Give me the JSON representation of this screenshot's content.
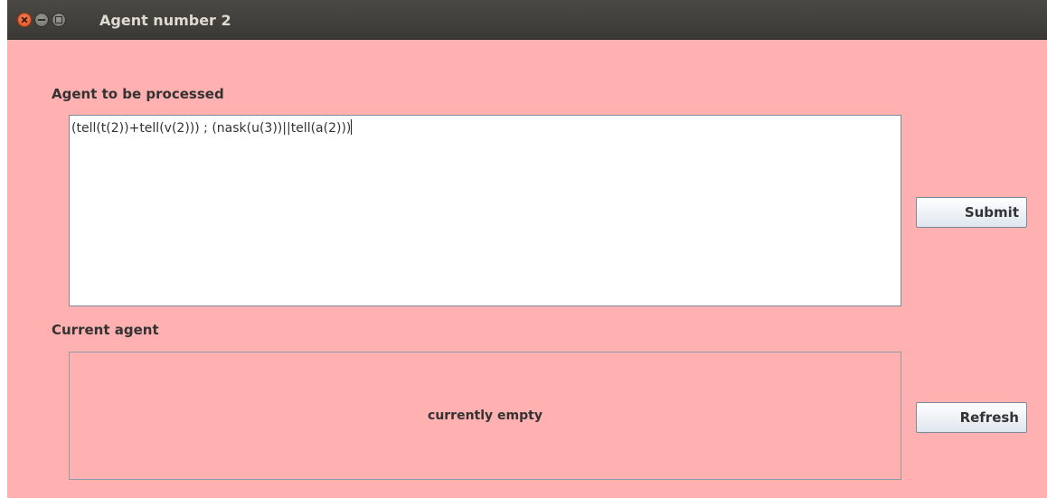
{
  "window": {
    "title": "Agent number 2",
    "controls": [
      "close-icon",
      "minimize-icon",
      "maximize-icon"
    ]
  },
  "input_section": {
    "label": "Agent to be processed",
    "value": "(tell(t(2))+tell(v(2))) ; (nask(u(3))||tell(a(2)))",
    "submit_label": "Submit"
  },
  "current_section": {
    "label": "Current agent",
    "status": "currently empty",
    "refresh_label": "Refresh"
  },
  "colors": {
    "background": "#ffb0b0",
    "titlebar": "#3c3b37",
    "close_button": "#e8592a"
  }
}
